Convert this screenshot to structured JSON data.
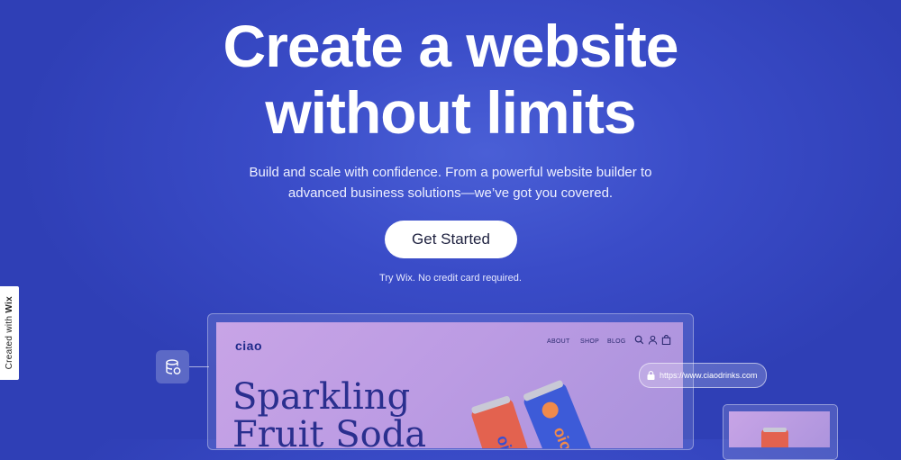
{
  "hero": {
    "title_line1": "Create a website",
    "title_line2": "without limits",
    "subtitle_line1": "Build and scale with confidence. From a powerful website builder to",
    "subtitle_line2": "advanced business solutions—we’ve got you covered.",
    "cta_label": "Get Started",
    "cta_note": "Try Wix. No credit card required."
  },
  "side_badge": {
    "prefix": "Created with ",
    "brand": "Wix"
  },
  "mockup": {
    "logo": "ciao",
    "nav": [
      "ABOUT",
      "SHOP",
      "BLOG"
    ],
    "nav_icons": [
      "search-icon",
      "user-icon",
      "bag-icon"
    ],
    "headline_line1": "Sparkling",
    "headline_line2": "Fruit Soda",
    "url": "https://www.ciaodrinks.com",
    "side_tile_icon": "database-icon"
  },
  "colors": {
    "background": "#3a4cc8",
    "mock_background": "#c8a4e6",
    "mock_text": "#2a2f8e",
    "cta_background": "#ffffff"
  }
}
